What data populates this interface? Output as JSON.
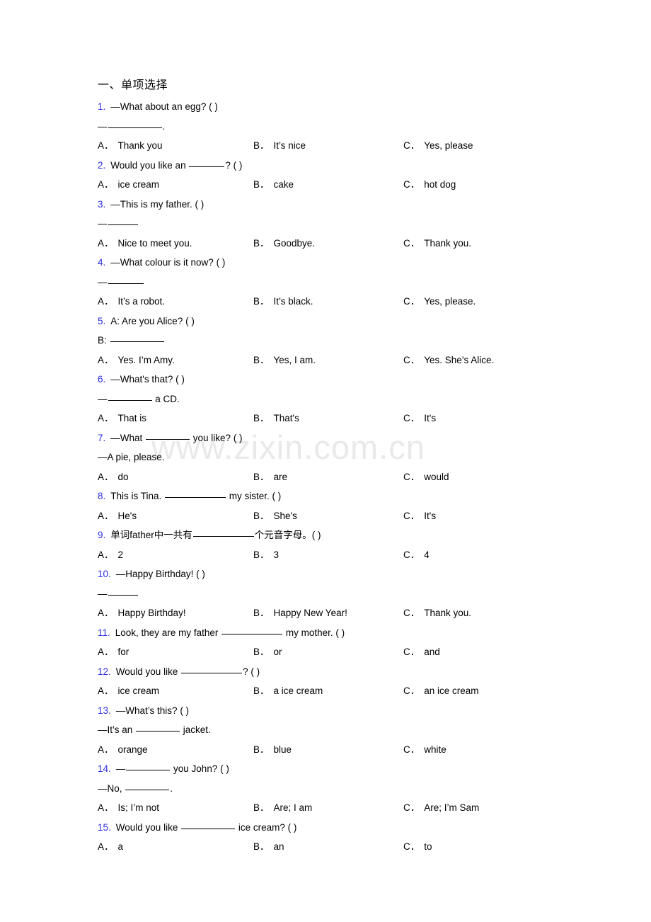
{
  "document": {
    "watermark": "www.zixin.com.cn",
    "section_heading": "一、单项选择",
    "accent_number_color": "#2b2ee0",
    "text_color": "#000000",
    "background_color": "#ffffff",
    "watermark_color": "#e9e9e9"
  },
  "questions": [
    {
      "num": "1.",
      "stem": "—What about an egg? (    )",
      "cont_pre": "—",
      "cont_blank": "lg",
      "cont_post": ".",
      "options": [
        {
          "letter": "A．",
          "text": "Thank you"
        },
        {
          "letter": "B．",
          "text": "It’s nice"
        },
        {
          "letter": "C．",
          "text": "Yes, please"
        }
      ]
    },
    {
      "num": "2.",
      "stem_pre": "Would you like an ",
      "stem_blank": "sm",
      "stem_post": "? (   )",
      "options": [
        {
          "letter": "A．",
          "text": "ice cream"
        },
        {
          "letter": "B．",
          "text": "cake"
        },
        {
          "letter": "C．",
          "text": "hot dog"
        }
      ]
    },
    {
      "num": "3.",
      "stem": "—This is my father. (    )",
      "cont_pre": "—",
      "cont_blank": "xs",
      "cont_post": "",
      "options": [
        {
          "letter": "A．",
          "text": "Nice to meet you."
        },
        {
          "letter": "B．",
          "text": "Goodbye."
        },
        {
          "letter": "C．",
          "text": "Thank you."
        }
      ]
    },
    {
      "num": "4.",
      "stem": "—What colour is it now? (    )",
      "cont_pre": "—",
      "cont_blank": "sm",
      "cont_post": "",
      "options": [
        {
          "letter": "A．",
          "text": "It’s a robot."
        },
        {
          "letter": "B．",
          "text": "It’s black."
        },
        {
          "letter": "C．",
          "text": "Yes, please."
        }
      ]
    },
    {
      "num": "5.",
      "stem": "A: Are you Alice?  (     )",
      "cont_pre": "B: ",
      "cont_blank": "lg",
      "cont_post": "",
      "options": [
        {
          "letter": "A．",
          "text": "Yes. I’m Amy."
        },
        {
          "letter": "B．",
          "text": "Yes, I am."
        },
        {
          "letter": "C．",
          "text": "Yes. She’s Alice."
        }
      ]
    },
    {
      "num": "6.",
      "stem": "—What's that? (   )",
      "cont_pre": "—",
      "cont_blank": "md",
      "cont_post": " a CD.",
      "options": [
        {
          "letter": "A．",
          "text": "That is"
        },
        {
          "letter": "B．",
          "text": "That's"
        },
        {
          "letter": "C．",
          "text": "It's"
        }
      ]
    },
    {
      "num": "7.",
      "stem_pre": "—What ",
      "stem_blank": "md",
      "stem_post": " you like? (   )",
      "cont_pre": "—A pie, please.",
      "options": [
        {
          "letter": "A．",
          "text": "do"
        },
        {
          "letter": "B．",
          "text": "are"
        },
        {
          "letter": "C．",
          "text": "would"
        }
      ]
    },
    {
      "num": "8.",
      "stem_pre": "This is Tina. ",
      "stem_blank": "xl",
      "stem_post": " my sister. (  )",
      "options": [
        {
          "letter": "A．",
          "text": "He's"
        },
        {
          "letter": "B．",
          "text": "She's"
        },
        {
          "letter": "C．",
          "text": "It's"
        }
      ]
    },
    {
      "num": "9.",
      "stem_pre": "单词father中一共有",
      "stem_blank": "xl",
      "stem_post": "个元音字母。(  )",
      "options": [
        {
          "letter": "A．",
          "text": "2"
        },
        {
          "letter": "B．",
          "text": "3"
        },
        {
          "letter": "C．",
          "text": "4"
        }
      ]
    },
    {
      "num": "10.",
      "stem": "—Happy Birthday! (   )",
      "cont_pre": "—",
      "cont_blank": "xs",
      "cont_post": "",
      "options": [
        {
          "letter": "A．",
          "text": "Happy Birthday!"
        },
        {
          "letter": "B．",
          "text": "Happy New Year!"
        },
        {
          "letter": "C．",
          "text": "Thank you."
        }
      ]
    },
    {
      "num": "11.",
      "stem_pre": "Look, they are my father ",
      "stem_blank": "xl",
      "stem_post": " my mother. (  )",
      "options": [
        {
          "letter": "A．",
          "text": "for"
        },
        {
          "letter": "B．",
          "text": "or"
        },
        {
          "letter": "C．",
          "text": "and"
        }
      ]
    },
    {
      "num": "12.",
      "stem_pre": "Would you like ",
      "stem_blank": "xl",
      "stem_post": "? (   )",
      "options": [
        {
          "letter": "A．",
          "text": "ice cream"
        },
        {
          "letter": "B．",
          "text": "a ice cream"
        },
        {
          "letter": "C．",
          "text": "an ice cream"
        }
      ]
    },
    {
      "num": "13.",
      "stem": "—What’s this? (   )",
      "cont_pre": "—It’s an ",
      "cont_blank": "md",
      "cont_post": " jacket.",
      "options": [
        {
          "letter": "A．",
          "text": "orange"
        },
        {
          "letter": "B．",
          "text": "blue"
        },
        {
          "letter": "C．",
          "text": "white"
        }
      ]
    },
    {
      "num": "14.",
      "stem_pre": "—",
      "stem_blank": "md",
      "stem_post": " you John? (   )",
      "cont_pre": "—No, ",
      "cont_blank": "md",
      "cont_post": ".",
      "options": [
        {
          "letter": "A．",
          "text": "Is; I’m not"
        },
        {
          "letter": "B．",
          "text": "Are; I am"
        },
        {
          "letter": "C．",
          "text": "Are; I’m Sam"
        }
      ]
    },
    {
      "num": "15.",
      "stem_pre": "Would you like ",
      "stem_blank": "lg",
      "stem_post": " ice cream? (  )",
      "options": [
        {
          "letter": "A．",
          "text": "a"
        },
        {
          "letter": "B．",
          "text": "an"
        },
        {
          "letter": "C．",
          "text": "to"
        }
      ]
    }
  ]
}
